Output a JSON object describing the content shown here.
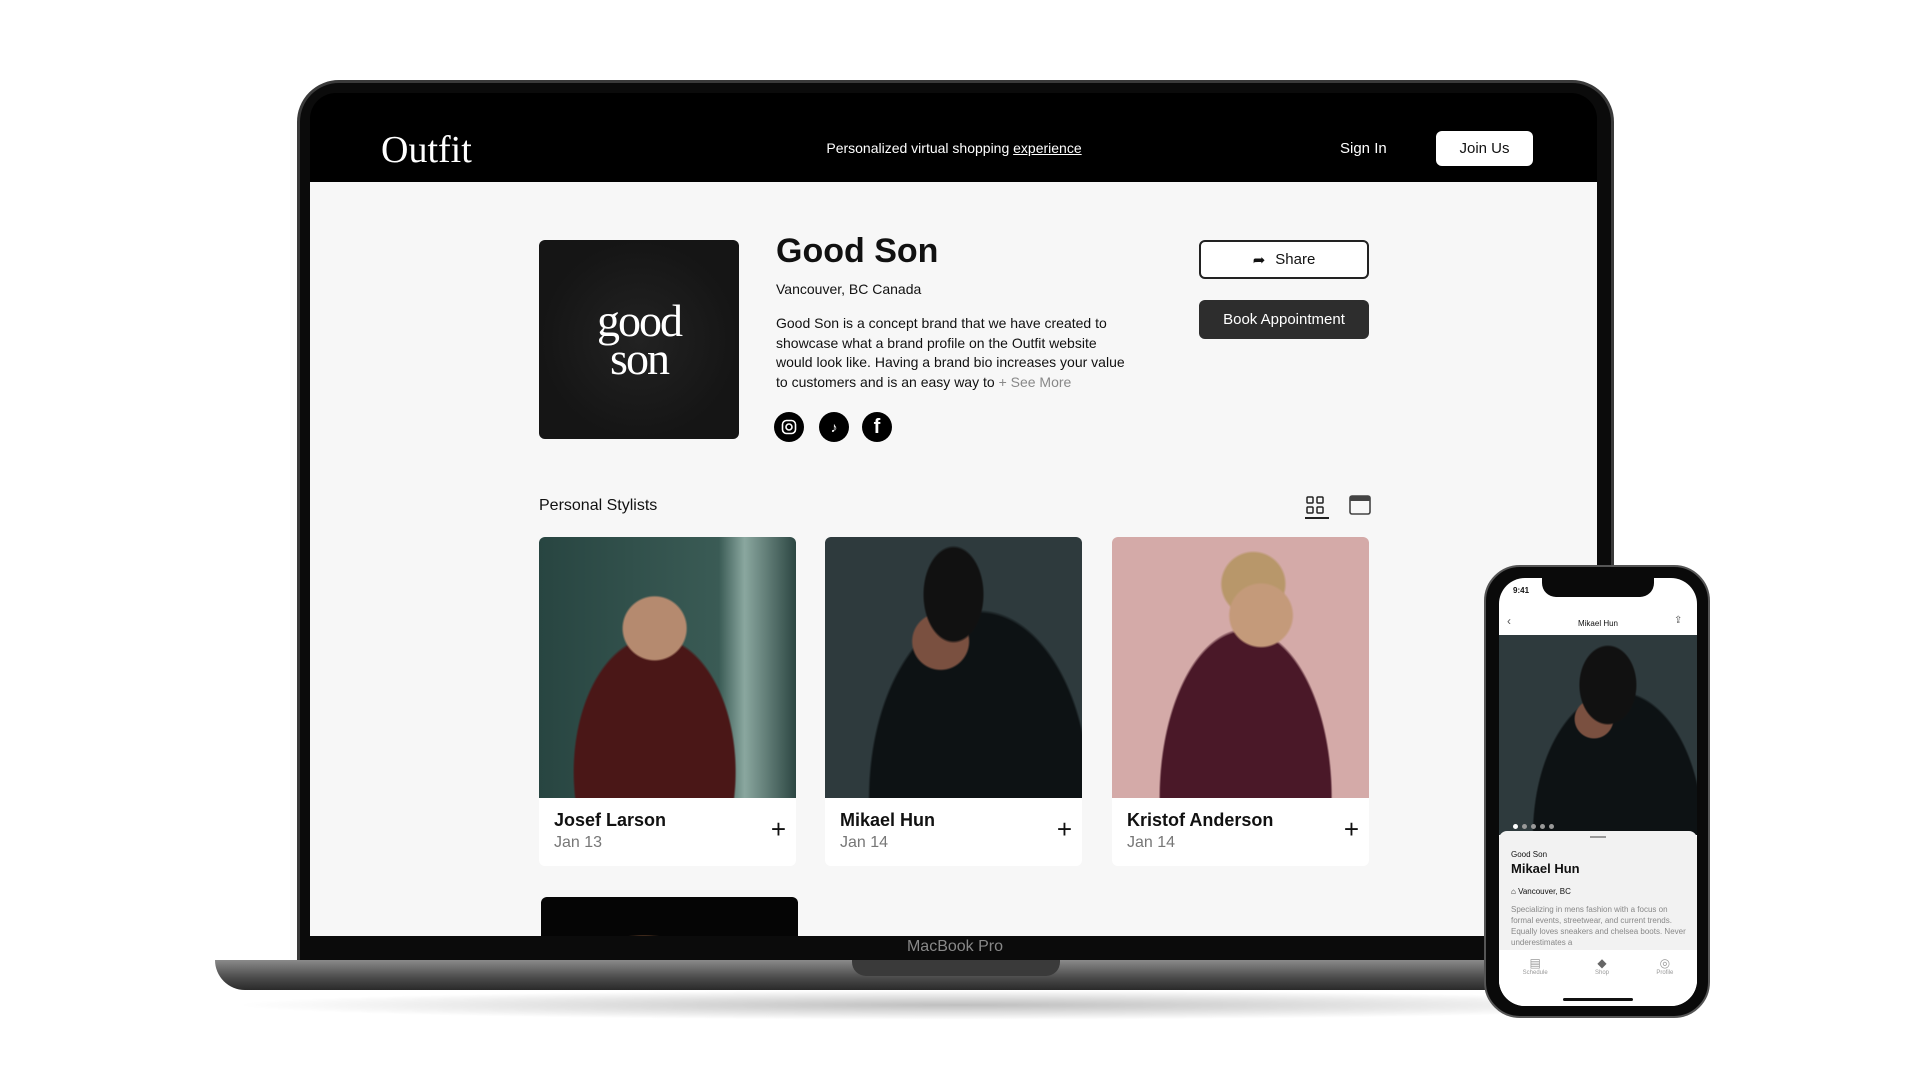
{
  "device_label": "MacBook Pro",
  "header": {
    "logo": "Outfit",
    "tagline_prefix": "Personalized virtual shopping ",
    "tagline_link": "experience",
    "sign_in": "Sign In",
    "join": "Join Us"
  },
  "brand": {
    "logo_line1": "good",
    "logo_line2": "son",
    "name": "Good Son",
    "location": "Vancouver, BC Canada",
    "bio": "Good Son is a concept brand that we have created to showcase what a brand profile on the Outfit website would look like. Having a brand bio increases your value to customers and is an easy way to",
    "see_more": "+ See More",
    "socials": [
      "instagram-icon",
      "tiktok-icon",
      "facebook-icon"
    ],
    "share": "Share",
    "book": "Book Appointment"
  },
  "stylists": {
    "heading": "Personal Stylists",
    "view_icons": [
      "grid-icon",
      "calendar-icon"
    ],
    "items": [
      {
        "name": "Josef Larson",
        "date": "Jan 13"
      },
      {
        "name": "Mikael Hun",
        "date": "Jan 14"
      },
      {
        "name": "Kristof Anderson",
        "date": "Jan 14"
      }
    ]
  },
  "phone": {
    "time": "9:41",
    "title": "Mikael Hun",
    "brand": "Good Son",
    "name": "Mikael Hun",
    "location": "Vancouver, BC",
    "bio": "Specializing in mens fashion with a focus on formal events, streetwear, and current trends. Equally loves sneakers and chelsea boots. Never underestimates a",
    "tabs": [
      "Schedule",
      "Shop",
      "Profile"
    ]
  }
}
